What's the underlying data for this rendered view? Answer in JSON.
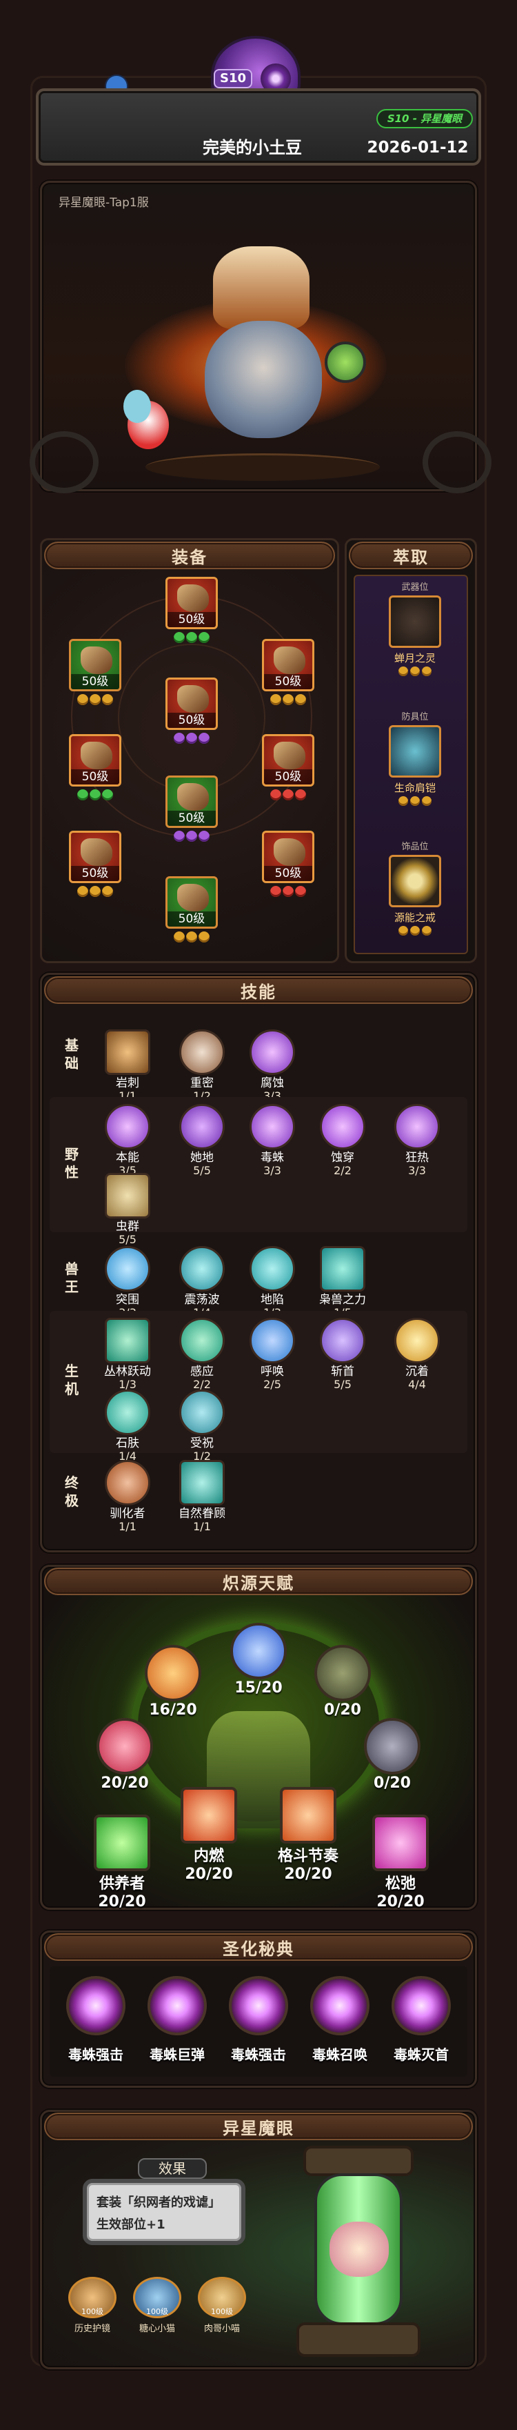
{
  "header": {
    "season_badge": "S10",
    "season_tag": "S10 - 异星魔眼",
    "player_name": "完美的小土豆",
    "date": "2026-01-12"
  },
  "hero": {
    "server_label": "异星魔眼-Tap1服"
  },
  "equipment": {
    "title": "装备",
    "slots": [
      {
        "level": "50级",
        "star": "gr"
      },
      {
        "level": "50级",
        "star": "g"
      },
      {
        "level": "50级",
        "star": "g"
      },
      {
        "level": "50级",
        "star": "p"
      },
      {
        "level": "50级",
        "star": "gr"
      },
      {
        "level": "50级",
        "star": "r"
      },
      {
        "level": "50级",
        "star": "g"
      },
      {
        "level": "50级",
        "star": "p"
      },
      {
        "level": "50级",
        "star": "r"
      },
      {
        "level": "50级",
        "star": "g"
      },
      {
        "level": "50级",
        "star": "g"
      }
    ]
  },
  "extract": {
    "title": "萃取",
    "items": [
      {
        "caption": "武器位",
        "name": "蝉月之灵"
      },
      {
        "caption": "防具位",
        "name": "生命肩铠"
      },
      {
        "caption": "饰品位",
        "name": "源能之戒"
      }
    ]
  },
  "skills": {
    "title": "技能",
    "rows": [
      {
        "label": "基础",
        "items": [
          {
            "name": "岩刺",
            "count": "1/1",
            "color": "#7a4a1c"
          },
          {
            "name": "重密",
            "count": "1/2",
            "color": "#8a5a3a"
          },
          {
            "name": "腐蚀",
            "count": "3/3",
            "color": "#7a2dbf"
          }
        ]
      },
      {
        "label": "野性",
        "items": [
          {
            "name": "本能",
            "count": "3/5",
            "color": "#7a2dbf"
          },
          {
            "name": "她地",
            "count": "5/5",
            "color": "#6a26b0"
          },
          {
            "name": "毒蛛",
            "count": "3/3",
            "color": "#7a2dbf"
          },
          {
            "name": "蚀穿",
            "count": "2/2",
            "color": "#8a30d0"
          },
          {
            "name": "狂热",
            "count": "3/3",
            "color": "#7a2dbf"
          },
          {
            "name": "虫群",
            "count": "5/5",
            "color": "#9a7a40"
          }
        ]
      },
      {
        "label": "兽王",
        "items": [
          {
            "name": "突围",
            "count": "3/3",
            "color": "#2a8fd0"
          },
          {
            "name": "震荡波",
            "count": "1/4",
            "color": "#1e8a9a"
          },
          {
            "name": "地陷",
            "count": "1/3",
            "color": "#1e9aa0"
          },
          {
            "name": "枭兽之力",
            "count": "1/5",
            "color": "#1a8a8a"
          }
        ]
      },
      {
        "label": "生机",
        "items": [
          {
            "name": "丛林跃动",
            "count": "1/3",
            "color": "#1a8a70"
          },
          {
            "name": "感应",
            "count": "2/2",
            "color": "#1a9a7a"
          },
          {
            "name": "呼唤",
            "count": "2/5",
            "color": "#2a7ad0"
          },
          {
            "name": "斩首",
            "count": "5/5",
            "color": "#6a40c0"
          },
          {
            "name": "沉着",
            "count": "4/4",
            "color": "#d09020"
          },
          {
            "name": "石肤",
            "count": "1/4",
            "color": "#1a9a8a"
          },
          {
            "name": "受祝",
            "count": "1/2",
            "color": "#2a8a9a"
          }
        ]
      },
      {
        "label": "终极",
        "items": [
          {
            "name": "驯化者",
            "count": "1/1",
            "color": "#a04a1a"
          },
          {
            "name": "自然眷顾",
            "count": "1/1",
            "color": "#1a8a80"
          }
        ]
      }
    ]
  },
  "talents": {
    "title": "炽源天赋",
    "items": [
      {
        "id": "t-top",
        "value": "15/20",
        "name": "",
        "color": "#2a5ad0"
      },
      {
        "id": "t-ul",
        "value": "16/20",
        "name": "",
        "color": "#d0601a"
      },
      {
        "id": "t-ur",
        "value": "0/20",
        "name": "",
        "color": "#4a5030"
      },
      {
        "id": "t-ml",
        "value": "20/20",
        "name": "",
        "color": "#c02040"
      },
      {
        "id": "t-mr",
        "value": "0/20",
        "name": "",
        "color": "#3a3a4a"
      },
      {
        "id": "t-b1",
        "value": "20/20",
        "name": "供养者",
        "color": "#2aa02a"
      },
      {
        "id": "t-b2",
        "value": "20/20",
        "name": "内燃",
        "color": "#d0401a"
      },
      {
        "id": "t-b3",
        "value": "20/20",
        "name": "格斗节奏",
        "color": "#d0501a"
      },
      {
        "id": "t-b4",
        "value": "20/20",
        "name": "松弛",
        "color": "#c02aa0"
      }
    ]
  },
  "sacred": {
    "title": "圣化秘典",
    "items": [
      "毒蛛强击",
      "毒蛛巨弹",
      "毒蛛强击",
      "毒蛛召唤",
      "毒蛛灭首"
    ]
  },
  "eye": {
    "title": "异星魔眼",
    "effect_label": "效果",
    "effect_line1": "套装「织网者的戏谑」",
    "effect_line2": "生效部位+1",
    "gear": [
      {
        "name": "历史护镜",
        "level": "100级"
      },
      {
        "name": "糖心小猫",
        "level": "100级"
      },
      {
        "name": "肉哥小喵",
        "level": "100级"
      }
    ]
  }
}
